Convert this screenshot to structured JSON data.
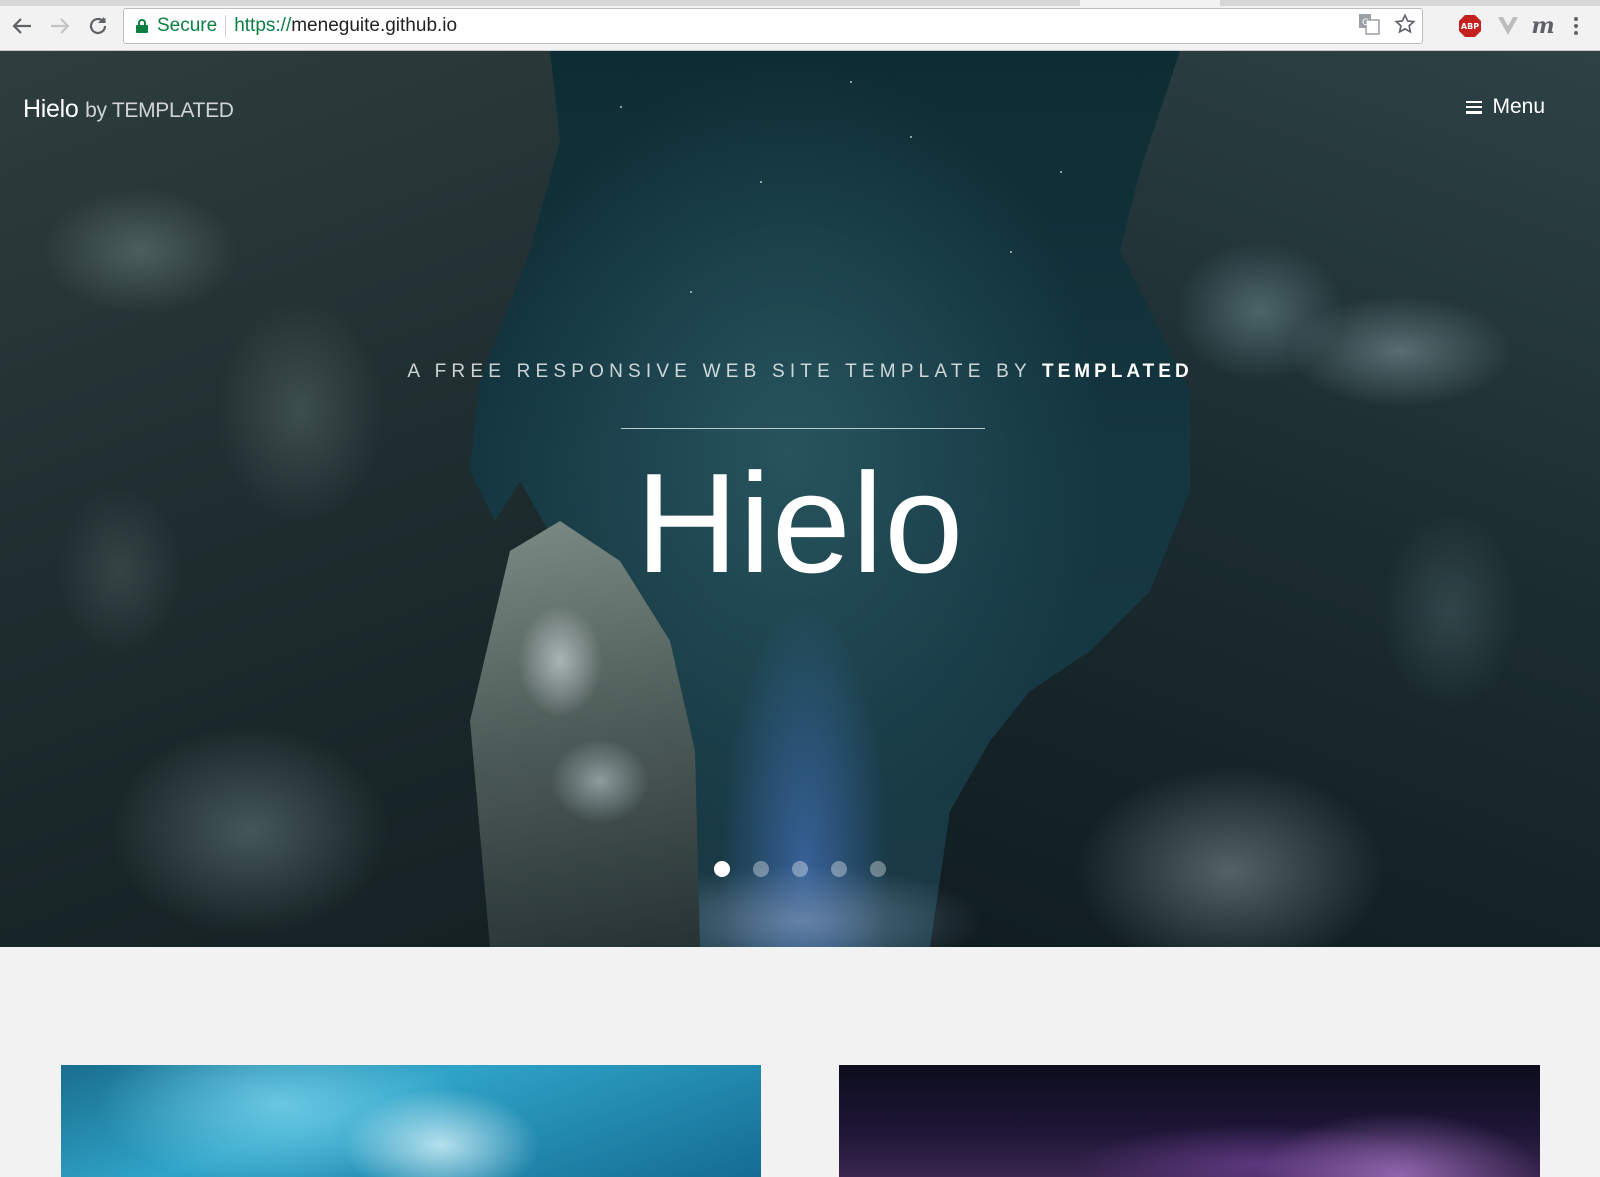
{
  "browser": {
    "secure_label": "Secure",
    "url_scheme": "https://",
    "url_host": "meneguite.github.io",
    "extensions": {
      "adblock_label": "ABP",
      "m_label": "m"
    }
  },
  "header": {
    "brand_name": "Hielo",
    "brand_by": "by TEMPLATED",
    "menu_label": "Menu"
  },
  "hero": {
    "tagline_prefix": "A FREE RESPONSIVE WEB SITE TEMPLATE BY",
    "tagline_strong": "TEMPLATED",
    "title": "Hielo",
    "slides_total": 5,
    "active_slide": 1
  },
  "colors": {
    "secure_green": "#0b8043",
    "hero_text": "#ffffff",
    "page_bg": "#f2f2f2"
  }
}
